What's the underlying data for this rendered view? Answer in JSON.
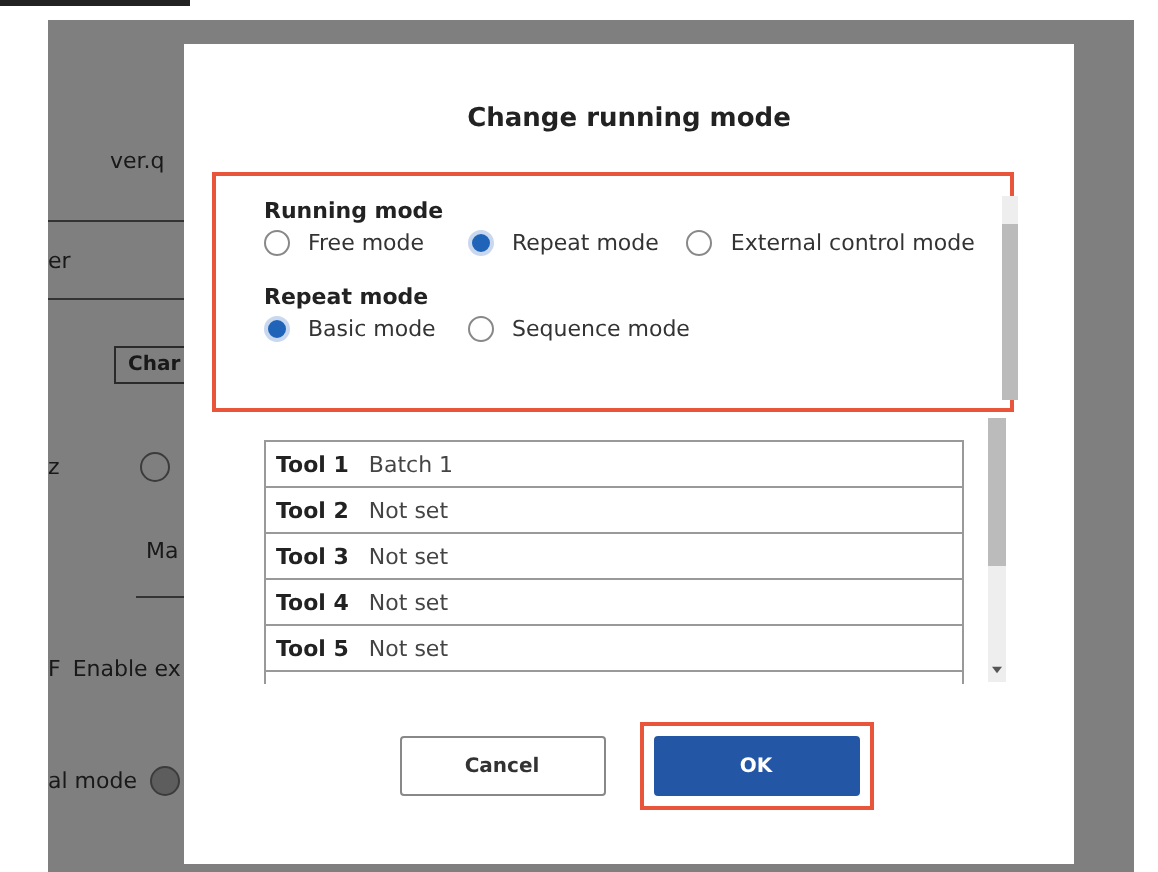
{
  "background": {
    "version_text": "ver.q",
    "field_text": "er",
    "button_label": "Char",
    "row_label": "z",
    "radio": {
      "selected": false
    },
    "tab_label": "Ma",
    "flag_text": "F",
    "checkbox_label": "Enable ex",
    "mode_label": "al mode",
    "mode_radio": {
      "selected": true
    }
  },
  "dialog": {
    "title": "Change running mode",
    "mode_panel": {
      "highlighted": true,
      "groups": [
        {
          "label": "Running mode",
          "options": [
            {
              "label": "Free mode",
              "selected": false
            },
            {
              "label": "Repeat mode",
              "selected": true
            },
            {
              "label": "External control mode",
              "selected": false
            }
          ]
        },
        {
          "label": "Repeat mode",
          "options": [
            {
              "label": "Basic mode",
              "selected": true
            },
            {
              "label": "Sequence mode",
              "selected": false
            }
          ]
        }
      ]
    },
    "tools": [
      {
        "tool": "Tool 1",
        "value": "Batch 1"
      },
      {
        "tool": "Tool 2",
        "value": "Not set"
      },
      {
        "tool": "Tool 3",
        "value": "Not set"
      },
      {
        "tool": "Tool 4",
        "value": "Not set"
      },
      {
        "tool": "Tool 5",
        "value": "Not set"
      }
    ],
    "buttons": [
      {
        "label": "Cancel",
        "kind": "secondary",
        "highlighted": false
      },
      {
        "label": "OK",
        "kind": "primary",
        "highlighted": true
      }
    ]
  }
}
